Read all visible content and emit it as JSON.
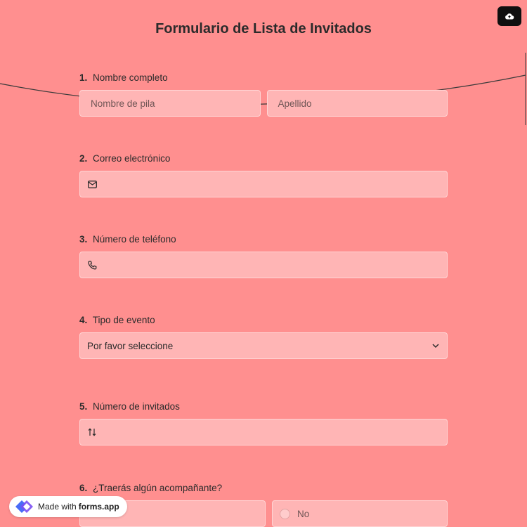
{
  "header": {
    "title": "Formulario de Lista de Invitados"
  },
  "questions": {
    "q1": {
      "num": "1.",
      "label": "Nombre completo",
      "first_placeholder": "Nombre de pila",
      "last_placeholder": "Apellido"
    },
    "q2": {
      "num": "2.",
      "label": "Correo electrónico",
      "icon": "envelope-icon"
    },
    "q3": {
      "num": "3.",
      "label": "Número de teléfono",
      "icon": "phone-icon"
    },
    "q4": {
      "num": "4.",
      "label": "Tipo de evento",
      "selected": "Por favor seleccione",
      "icon": "chevron-down-icon"
    },
    "q5": {
      "num": "5.",
      "label": "Número de invitados",
      "icon": "sort-arrows-icon"
    },
    "q6": {
      "num": "6.",
      "label": "¿Traerás algún acompañante?",
      "option_no": "No"
    }
  },
  "badge": {
    "prefix": "Made with",
    "brand": "forms.app"
  },
  "colors": {
    "background": "#ff8f8f",
    "field": "#ffb5b5",
    "field_border": "#ffd4d4",
    "text": "#2b2b2b"
  }
}
